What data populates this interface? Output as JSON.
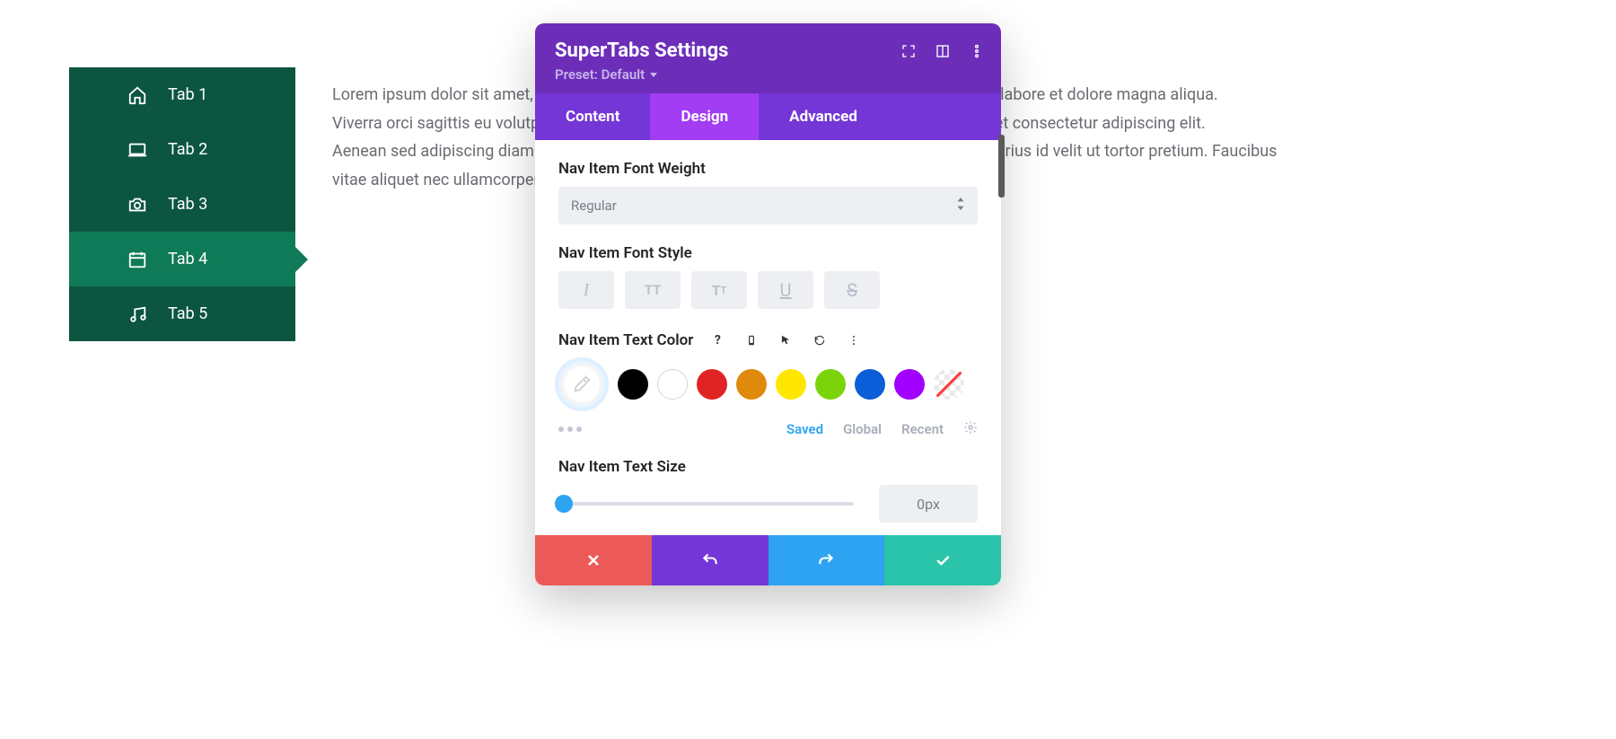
{
  "sidebar": {
    "items": [
      {
        "label": "Tab 1",
        "icon": "home-icon",
        "active": false
      },
      {
        "label": "Tab 2",
        "icon": "laptop-icon",
        "active": false
      },
      {
        "label": "Tab 3",
        "icon": "camera-icon",
        "active": false
      },
      {
        "label": "Tab 4",
        "icon": "calendar-icon",
        "active": true
      },
      {
        "label": "Tab 5",
        "icon": "music-icon",
        "active": false
      }
    ]
  },
  "body_text": "Lorem ipsum dolor sit amet, consectetur adipiscing elit, sed do eiusmod tempor incididunt ut labore et dolore magna aliqua.\nViverra orci sagittis eu volutpat odio facilisis mauris sit amet. Imperdiet dui accumsan sit amet consectetur adipiscing elit.\nAenean sed adipiscing diam donec adipiscing tristique. Vivamus at augue eget arcu dictum varius id velit ut tortor pretium. Faucibus\nvitae aliquet nec ullamcorper sit amet risus nullam eget.",
  "modal": {
    "title": "SuperTabs Settings",
    "preset_label": "Preset: Default",
    "head_icons": [
      "expand-icon",
      "columns-icon",
      "more-vert-icon"
    ],
    "tabs": [
      {
        "label": "Content",
        "active": false
      },
      {
        "label": "Design",
        "active": true
      },
      {
        "label": "Advanced",
        "active": false
      }
    ],
    "field_font_weight": {
      "label": "Nav Item Font Weight",
      "value": "Regular"
    },
    "field_font_style": {
      "label": "Nav Item Font Style",
      "buttons": [
        "italic-icon",
        "uppercase-icon",
        "smallcaps-icon",
        "underline-icon",
        "strikethrough-icon"
      ]
    },
    "field_text_color": {
      "label": "Nav Item Text Color",
      "label_icons": [
        "help-icon",
        "phone-icon",
        "cursor-icon",
        "reset-icon",
        "more-vert-icon"
      ],
      "swatches": [
        "picker",
        "#000000",
        "#ffffff",
        "#e02424",
        "#e08a0d",
        "#ffe600",
        "#7bd40a",
        "#0b5ed7",
        "#a100ff",
        "none"
      ],
      "palette_tabs": [
        "Saved",
        "Global",
        "Recent"
      ],
      "palette_tabs_active": 0
    },
    "field_text_size": {
      "label": "Nav Item Text Size",
      "value": "0px",
      "slider_pct": 0
    }
  },
  "footer_icons": [
    "close-icon",
    "undo-icon",
    "redo-icon",
    "check-icon"
  ]
}
